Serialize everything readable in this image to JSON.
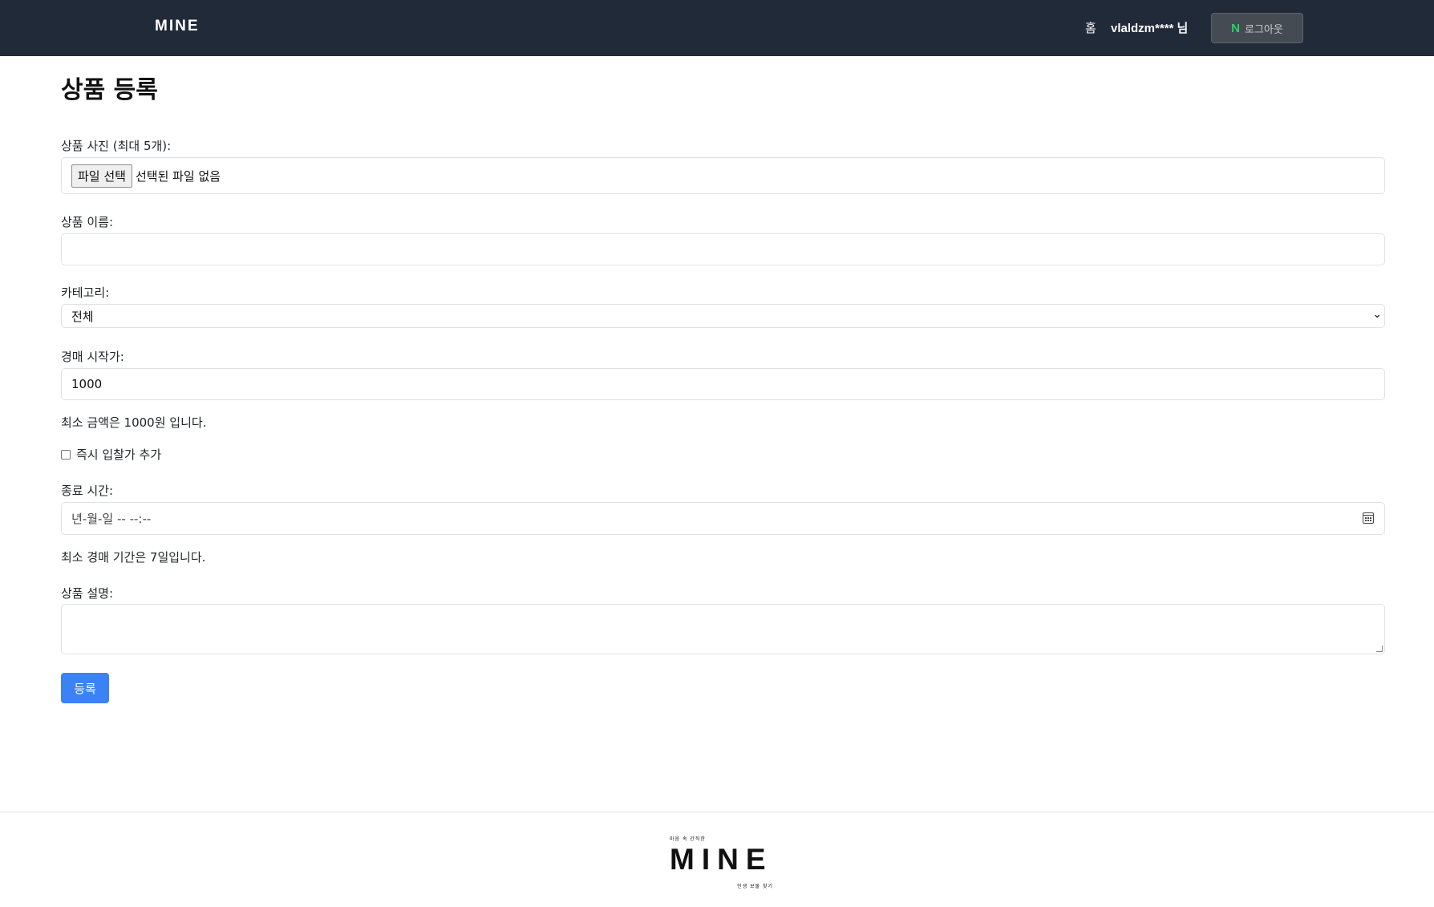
{
  "navbar": {
    "brand": "MINE",
    "home_label": "홈",
    "user_label": "vlaldzm**** 님",
    "logout_icon": "N",
    "logout_label": "로그아웃"
  },
  "page": {
    "title": "상품 등록"
  },
  "form": {
    "photos_label": "상품 사진 (최대 5개):",
    "file_button": "파일 선택",
    "file_status": "선택된 파일 없음",
    "name_label": "상품 이름:",
    "name_value": "",
    "category_label": "카테고리:",
    "category_selected": "전체",
    "start_price_label": "경매 시작가:",
    "start_price_value": "1000",
    "min_price_note": "최소 금액은 1000원 입니다.",
    "instant_bid_label": "즉시 입찰가 추가",
    "instant_bid_checked": false,
    "end_time_label": "종료 시간:",
    "end_time_placeholder": "년-월-일 -- --:--",
    "min_period_note": "최소 경매 기간은 7일입니다.",
    "description_label": "상품 설명:",
    "description_value": "",
    "submit_label": "등록"
  },
  "footer": {
    "logo_top": "마음 속 간직한",
    "logo_main": "MINE",
    "logo_bottom": "인생 보물 찾기"
  },
  "colors": {
    "navbar_bg": "#212a38",
    "primary_button": "#3b82f6",
    "naver_green": "#2bd16a"
  }
}
